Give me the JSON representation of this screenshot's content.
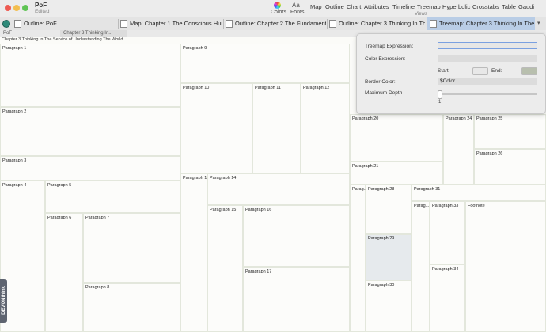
{
  "window": {
    "title": "PoF",
    "subtitle": "Edited"
  },
  "toolbar": {
    "colors_label": "Colors",
    "fonts_label": "Fonts",
    "fonts_glyph": "Aa",
    "views_label": "Views",
    "views": [
      "Map",
      "Outline",
      "Chart",
      "Attributes",
      "Timeline",
      "Treemap",
      "Hyperbolic",
      "Crosstabs",
      "Table",
      "Gaudi"
    ]
  },
  "tabs": [
    {
      "label": "Outline: PoF"
    },
    {
      "label": "Map: Chapter 1 The Conscious Hum..."
    },
    {
      "label": "Outline: Chapter 2 The Fundament..."
    },
    {
      "label": "Outline: Chapter 3 Thinking In The..."
    },
    {
      "label": "Treemap: Chapter 3 Thinking In The..."
    }
  ],
  "breadcrumbs": [
    "PoF",
    "Chapter 3 Thinking In..."
  ],
  "treemap": {
    "title": "Chapter 3 Thinking In The Service of Understanding The World",
    "cells": {
      "p1": "Paragraph 1",
      "p2": "Paragraph 2",
      "p3": "Paragraph 3",
      "p4": "Paragraph 4",
      "p5": "Paragraph 5",
      "p6": "Paragraph 6",
      "p7": "Paragraph 7",
      "p8": "Paragraph 8",
      "p9": "Paragraph 9",
      "p10": "Paragraph 10",
      "p11": "Paragraph 11",
      "p12": "Paragraph 12",
      "p13": "Paragraph 13",
      "p14": "Paragraph 14",
      "p15": "Paragraph 15",
      "p16": "Paragraph 16",
      "p17": "Paragraph 17",
      "p20": "Paragraph 20",
      "p21": "Paragraph 21",
      "p24": "Paragraph 24",
      "p25": "Paragraph 25",
      "p26": "Paragraph 26",
      "p27": "Parag...",
      "p28": "Paragraph 28",
      "p29": "Paragraph 29",
      "p30": "Paragraph 30",
      "p31": "Paragraph 31",
      "p32": "Parag...",
      "p33": "Paragraph 33",
      "p34": "Paragraph 34",
      "footnote": "Footnote"
    }
  },
  "popover": {
    "treemap_expression_label": "Treemap Expression:",
    "treemap_expression_value": "",
    "color_expression_label": "Color Expression:",
    "color_expression_value": "",
    "start_label": "Start:",
    "end_label": "End:",
    "start_color": "#e8e8e8",
    "end_color": "#b8bfae",
    "border_color_label": "Border Color:",
    "border_color_value": "$Color",
    "max_depth_label": "Maximum Depth",
    "depth_min": "1",
    "depth_max": "–"
  },
  "side_tab": "DEVONthink",
  "colors": {
    "close": "#ee5a52",
    "minimize": "#f3be4f",
    "zoom": "#5fc454",
    "active_tab": "#b9cde6",
    "highlight_cell": "#e6eaed"
  }
}
